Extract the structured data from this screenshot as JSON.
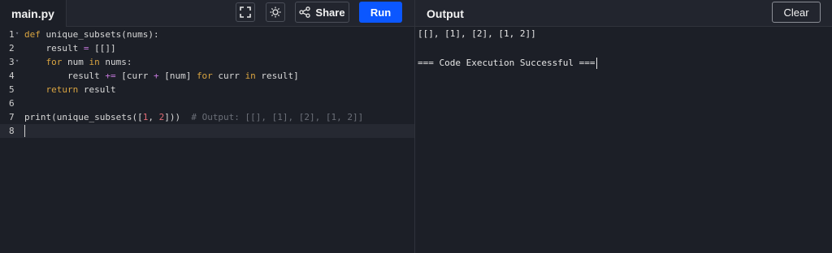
{
  "editor": {
    "file_name": "main.py",
    "lines": [
      {
        "n": "1",
        "fold": true
      },
      {
        "n": "2"
      },
      {
        "n": "3",
        "fold": true
      },
      {
        "n": "4"
      },
      {
        "n": "5"
      },
      {
        "n": "6"
      },
      {
        "n": "7"
      },
      {
        "n": "8"
      }
    ],
    "code": {
      "l1_kw": "def",
      "l1_rest": " unique_subsets(nums):",
      "l2_text": "    result ",
      "l2_op": "=",
      "l2_rest": " [[]]",
      "l3_indent": "    ",
      "l3_kw_for": "for",
      "l3_mid": " num ",
      "l3_kw_in": "in",
      "l3_rest": " nums:",
      "l4_a": "        result ",
      "l4_op1": "+=",
      "l4_b": " [curr ",
      "l4_op2": "+",
      "l4_c": " [num] ",
      "l4_kw_for": "for",
      "l4_d": " curr ",
      "l4_kw_in": "in",
      "l4_e": " result]",
      "l5_indent": "    ",
      "l5_kw": "return",
      "l5_rest": " result",
      "l7_a": "print(unique_subsets([",
      "l7_n1": "1",
      "l7_b": ", ",
      "l7_n2": "2",
      "l7_c": "]))",
      "l7_comment": "  # Output: [[], [1], [2], [1, 2]]"
    }
  },
  "toolbar": {
    "fullscreen_icon": "fullscreen-icon",
    "theme_icon": "sun-icon",
    "share_icon": "share-icon",
    "share_label": "Share",
    "run_label": "Run"
  },
  "output": {
    "title": "Output",
    "clear_label": "Clear",
    "lines": [
      "[[], [1], [2], [1, 2]]",
      "",
      "=== Code Execution Successful ==="
    ]
  },
  "colors": {
    "background": "#1c1f27",
    "run_button": "#0b57ff",
    "keyword": "#d9a441",
    "operator": "#c678dd",
    "number": "#e06c75",
    "comment": "#6b6f78"
  }
}
